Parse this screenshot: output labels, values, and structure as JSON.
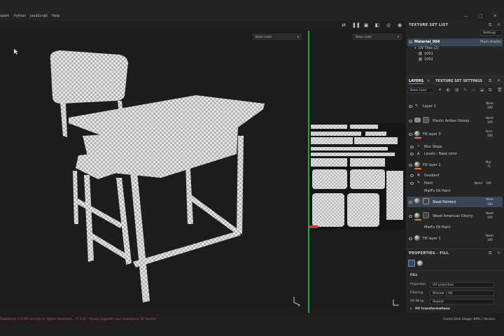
{
  "menu": {
    "items": [
      "xport",
      "Python",
      "JavaScript",
      "Help"
    ]
  },
  "viewport3d": {
    "channel": "Base color",
    "axis_label": "z"
  },
  "viewport2d": {
    "channel": "Base color"
  },
  "texture_set_list": {
    "title": "TEXTURE SET LIST",
    "settings_label": "Settings",
    "material": "Material_004",
    "shader": "Main shader",
    "uv_group": "UV Tiles (2)",
    "tiles": [
      "1001",
      "1002"
    ]
  },
  "layers_panel": {
    "tab_layers": "LAYERS",
    "tab_settings": "TEXTURE SET SETTINGS",
    "channel": "Base color",
    "layers": [
      {
        "name": "Layer 1",
        "blend": "Norm",
        "opacity": "100",
        "kind": "paint"
      },
      {
        "name": "Plastic Amber Glossy",
        "blend": "Norm",
        "opacity": "100",
        "kind": "folder"
      },
      {
        "name": "Fill layer 3",
        "blend": "Scrn",
        "opacity": "100",
        "kind": "fill"
      },
      {
        "name": "Blur Slope",
        "blend": "",
        "opacity": "",
        "kind": "effect"
      },
      {
        "name": "Levels - Base color",
        "blend": "",
        "opacity": "",
        "kind": "effect"
      },
      {
        "name": "Fill layer 2",
        "blend": "Mul",
        "opacity": "71",
        "kind": "fill"
      },
      {
        "name": "Gradient",
        "blend": "",
        "opacity": "",
        "kind": "effect"
      },
      {
        "name": "Paint",
        "blend": "Norm",
        "opacity": "100",
        "kind": "effect"
      },
      {
        "name": "MatFx Oil Paint",
        "blend": "",
        "opacity": "",
        "kind": "effect"
      },
      {
        "name": "Steel Painted",
        "blend": "Norm",
        "opacity": "100",
        "kind": "material"
      },
      {
        "name": "Wood American Cherry",
        "blend": "Norm",
        "opacity": "100",
        "kind": "material"
      },
      {
        "name": "MatFx Oil Paint",
        "blend": "",
        "opacity": "",
        "kind": "effect"
      },
      {
        "name": "Fill layer 1",
        "blend": "Norm",
        "opacity": "100",
        "kind": "fill"
      }
    ]
  },
  "properties": {
    "title": "PROPERTIES - FILL",
    "section": "FILL",
    "projection_label": "Projection",
    "projection_value": "UV projection",
    "filtering_label": "Filtering",
    "filtering_value": "Bilinear | HQ",
    "uvwrap_label": "UV Wrap",
    "uvwrap_value": "Repeat",
    "transform_label": "UV transformations"
  },
  "status": {
    "message": "Substance 7.0 API version or higher detected... (7.1.0) - Please upgrade your Substance 3D Painter",
    "cache": "Cache Disk Usage:  89% | Version"
  },
  "colors": {
    "accent": "#2fa24a",
    "selection": "#3a4656",
    "warning": "#d05a4a"
  }
}
